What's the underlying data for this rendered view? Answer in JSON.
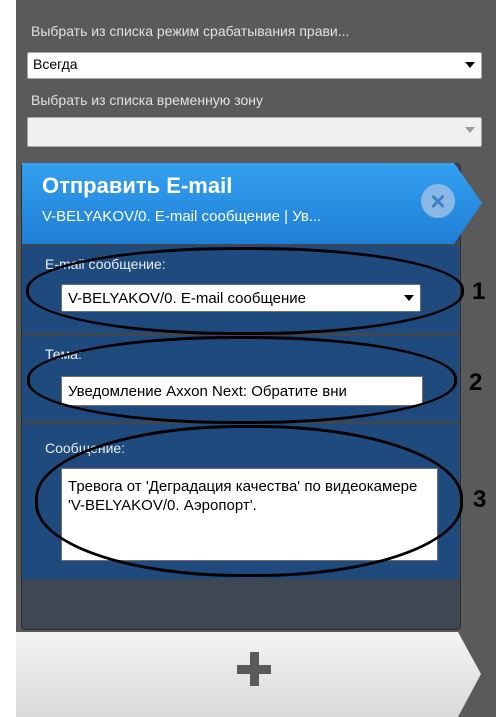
{
  "rule": {
    "mode_label": "Выбрать из списка режим срабатывания прави...",
    "mode_value": "Всегда",
    "timezone_label": "Выбрать из списка временную зону",
    "timezone_value": ""
  },
  "action": {
    "title": "Отправить E-mail",
    "subtitle": "V-BELYAKOV/0. E-mail сообщение | Ув...",
    "email_label": "E-mail сообщение:",
    "email_value": "V-BELYAKOV/0. E-mail сообщение",
    "subject_label": "Тема:",
    "subject_value": "Уведомление Axxon Next: Обратите вни",
    "message_label": "Сообщение:",
    "message_value": "Тревога от 'Деградация качества' по видеокамере 'V-BELYAKOV/0. Аэропорт'."
  },
  "annotations": [
    "1",
    "2",
    "3"
  ],
  "colors": {
    "header": "#2a8fe0",
    "section": "#1e4a7d",
    "background": "#5a5a5a"
  },
  "icons": {
    "close": "close-icon",
    "add": "plus-icon"
  }
}
